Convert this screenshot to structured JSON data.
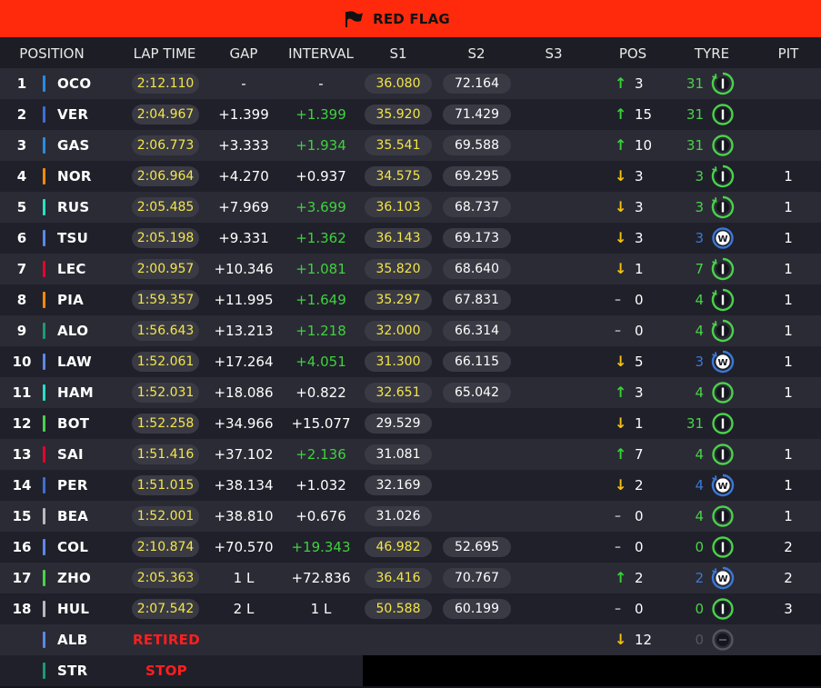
{
  "banner": {
    "title": "RED FLAG"
  },
  "headers": {
    "position": "POSITION",
    "lap_time": "LAP TIME",
    "gap": "GAP",
    "interval": "INTERVAL",
    "s1": "S1",
    "s2": "S2",
    "s3": "S3",
    "pos": "POS",
    "tyre": "TYRE",
    "pit": "PIT"
  },
  "colors": {
    "banner": "#ff2a0c",
    "green": "#3fd13f",
    "yellow": "#f2e64a",
    "blue": "#3a78d6",
    "red": "#ff1f1f"
  },
  "rows": [
    {
      "pos": "1",
      "driver": "OCO",
      "team_color": "#2a8be0",
      "lap": "2:12.110",
      "gap": "-",
      "interval": "-",
      "interval_green": false,
      "s1": "36.080",
      "s1_yellow": true,
      "s2": "72.164",
      "dir": "up",
      "pos_change": "3",
      "laps": "31",
      "laps_color": "green",
      "tyre": "intermediate",
      "tyre_used": true,
      "pit": ""
    },
    {
      "pos": "2",
      "driver": "VER",
      "team_color": "#3a6fd8",
      "lap": "2:04.967",
      "gap": "+1.399",
      "interval": "+1.399",
      "interval_green": true,
      "s1": "35.920",
      "s1_yellow": true,
      "s2": "71.429",
      "dir": "up",
      "pos_change": "15",
      "laps": "31",
      "laps_color": "green",
      "tyre": "intermediate",
      "tyre_used": false,
      "pit": ""
    },
    {
      "pos": "3",
      "driver": "GAS",
      "team_color": "#2a8be0",
      "lap": "2:06.773",
      "gap": "+3.333",
      "interval": "+1.934",
      "interval_green": true,
      "s1": "35.541",
      "s1_yellow": true,
      "s2": "69.588",
      "dir": "up",
      "pos_change": "10",
      "laps": "31",
      "laps_color": "green",
      "tyre": "intermediate",
      "tyre_used": false,
      "pit": ""
    },
    {
      "pos": "4",
      "driver": "NOR",
      "team_color": "#ff8a00",
      "lap": "2:06.964",
      "gap": "+4.270",
      "interval": "+0.937",
      "interval_green": false,
      "s1": "34.575",
      "s1_yellow": true,
      "s2": "69.295",
      "dir": "down",
      "pos_change": "3",
      "laps": "3",
      "laps_color": "green",
      "tyre": "intermediate",
      "tyre_used": true,
      "pit": "1"
    },
    {
      "pos": "5",
      "driver": "RUS",
      "team_color": "#27e0c6",
      "lap": "2:05.485",
      "gap": "+7.969",
      "interval": "+3.699",
      "interval_green": true,
      "s1": "36.103",
      "s1_yellow": true,
      "s2": "68.737",
      "dir": "down",
      "pos_change": "3",
      "laps": "3",
      "laps_color": "green",
      "tyre": "intermediate",
      "tyre_used": true,
      "pit": "1"
    },
    {
      "pos": "6",
      "driver": "TSU",
      "team_color": "#5a88e8",
      "lap": "2:05.198",
      "gap": "+9.331",
      "interval": "+1.362",
      "interval_green": true,
      "s1": "36.143",
      "s1_yellow": true,
      "s2": "69.173",
      "dir": "down",
      "pos_change": "3",
      "laps": "3",
      "laps_color": "blue",
      "tyre": "wet",
      "tyre_used": false,
      "pit": "1"
    },
    {
      "pos": "7",
      "driver": "LEC",
      "team_color": "#e8002d",
      "lap": "2:00.957",
      "gap": "+10.346",
      "interval": "+1.081",
      "interval_green": true,
      "s1": "35.820",
      "s1_yellow": true,
      "s2": "68.640",
      "dir": "down",
      "pos_change": "1",
      "laps": "7",
      "laps_color": "green",
      "tyre": "intermediate",
      "tyre_used": true,
      "pit": "1"
    },
    {
      "pos": "8",
      "driver": "PIA",
      "team_color": "#ff8a00",
      "lap": "1:59.357",
      "gap": "+11.995",
      "interval": "+1.649",
      "interval_green": true,
      "s1": "35.297",
      "s1_yellow": true,
      "s2": "67.831",
      "dir": "same",
      "pos_change": "0",
      "laps": "4",
      "laps_color": "green",
      "tyre": "intermediate",
      "tyre_used": true,
      "pit": "1"
    },
    {
      "pos": "9",
      "driver": "ALO",
      "team_color": "#1d9a73",
      "lap": "1:56.643",
      "gap": "+13.213",
      "interval": "+1.218",
      "interval_green": true,
      "s1": "32.000",
      "s1_yellow": true,
      "s2": "66.314",
      "dir": "same",
      "pos_change": "0",
      "laps": "4",
      "laps_color": "green",
      "tyre": "intermediate",
      "tyre_used": true,
      "pit": "1"
    },
    {
      "pos": "10",
      "driver": "LAW",
      "team_color": "#5a88e8",
      "lap": "1:52.061",
      "gap": "+17.264",
      "interval": "+4.051",
      "interval_green": true,
      "s1": "31.300",
      "s1_yellow": true,
      "s2": "66.115",
      "dir": "down",
      "pos_change": "5",
      "laps": "3",
      "laps_color": "blue",
      "tyre": "wet",
      "tyre_used": true,
      "pit": "1"
    },
    {
      "pos": "11",
      "driver": "HAM",
      "team_color": "#27e0c6",
      "lap": "1:52.031",
      "gap": "+18.086",
      "interval": "+0.822",
      "interval_green": false,
      "s1": "32.651",
      "s1_yellow": true,
      "s2": "65.042",
      "dir": "up",
      "pos_change": "3",
      "laps": "4",
      "laps_color": "green",
      "tyre": "intermediate",
      "tyre_used": false,
      "pit": "1"
    },
    {
      "pos": "12",
      "driver": "BOT",
      "team_color": "#4ad24a",
      "lap": "1:52.258",
      "gap": "+34.966",
      "interval": "+15.077",
      "interval_green": false,
      "s1": "29.529",
      "s1_yellow": false,
      "s2": "",
      "dir": "down",
      "pos_change": "1",
      "laps": "31",
      "laps_color": "green",
      "tyre": "intermediate",
      "tyre_used": false,
      "pit": ""
    },
    {
      "pos": "13",
      "driver": "SAI",
      "team_color": "#e8002d",
      "lap": "1:51.416",
      "gap": "+37.102",
      "interval": "+2.136",
      "interval_green": true,
      "s1": "31.081",
      "s1_yellow": false,
      "s2": "",
      "dir": "up",
      "pos_change": "7",
      "laps": "4",
      "laps_color": "green",
      "tyre": "intermediate",
      "tyre_used": false,
      "pit": "1"
    },
    {
      "pos": "14",
      "driver": "PER",
      "team_color": "#3a6fd8",
      "lap": "1:51.015",
      "gap": "+38.134",
      "interval": "+1.032",
      "interval_green": false,
      "s1": "32.169",
      "s1_yellow": false,
      "s2": "",
      "dir": "down",
      "pos_change": "2",
      "laps": "4",
      "laps_color": "blue",
      "tyre": "wet",
      "tyre_used": true,
      "pit": "1"
    },
    {
      "pos": "15",
      "driver": "BEA",
      "team_color": "#b6babd",
      "lap": "1:52.001",
      "gap": "+38.810",
      "interval": "+0.676",
      "interval_green": false,
      "s1": "31.026",
      "s1_yellow": false,
      "s2": "",
      "dir": "same",
      "pos_change": "0",
      "laps": "4",
      "laps_color": "green",
      "tyre": "intermediate",
      "tyre_used": false,
      "pit": "1"
    },
    {
      "pos": "16",
      "driver": "COL",
      "team_color": "#5a88e8",
      "lap": "2:10.874",
      "gap": "+70.570",
      "interval": "+19.343",
      "interval_green": true,
      "s1": "46.982",
      "s1_yellow": true,
      "s2": "52.695",
      "dir": "same",
      "pos_change": "0",
      "laps": "0",
      "laps_color": "green",
      "tyre": "intermediate",
      "tyre_used": false,
      "pit": "2"
    },
    {
      "pos": "17",
      "driver": "ZHO",
      "team_color": "#4ad24a",
      "lap": "2:05.363",
      "gap": "1 L",
      "interval": "+72.836",
      "interval_green": false,
      "s1": "36.416",
      "s1_yellow": true,
      "s2": "70.767",
      "dir": "up",
      "pos_change": "2",
      "laps": "2",
      "laps_color": "blue",
      "tyre": "wet",
      "tyre_used": true,
      "pit": "2"
    },
    {
      "pos": "18",
      "driver": "HUL",
      "team_color": "#b6babd",
      "lap": "2:07.542",
      "gap": "2 L",
      "interval": "1 L",
      "interval_green": false,
      "s1": "50.588",
      "s1_yellow": true,
      "s2": "60.199",
      "dir": "same",
      "pos_change": "0",
      "laps": "0",
      "laps_color": "green",
      "tyre": "intermediate",
      "tyre_used": false,
      "pit": "3"
    },
    {
      "pos": "",
      "driver": "ALB",
      "team_color": "#5a88e8",
      "status": "RETIRED",
      "dir": "down",
      "pos_change": "12",
      "laps": "0",
      "laps_color": "dim",
      "tyre": "none",
      "pit": ""
    },
    {
      "pos": "",
      "driver": "STR",
      "team_color": "#1d9a73",
      "status": "STOP",
      "black": true
    }
  ]
}
